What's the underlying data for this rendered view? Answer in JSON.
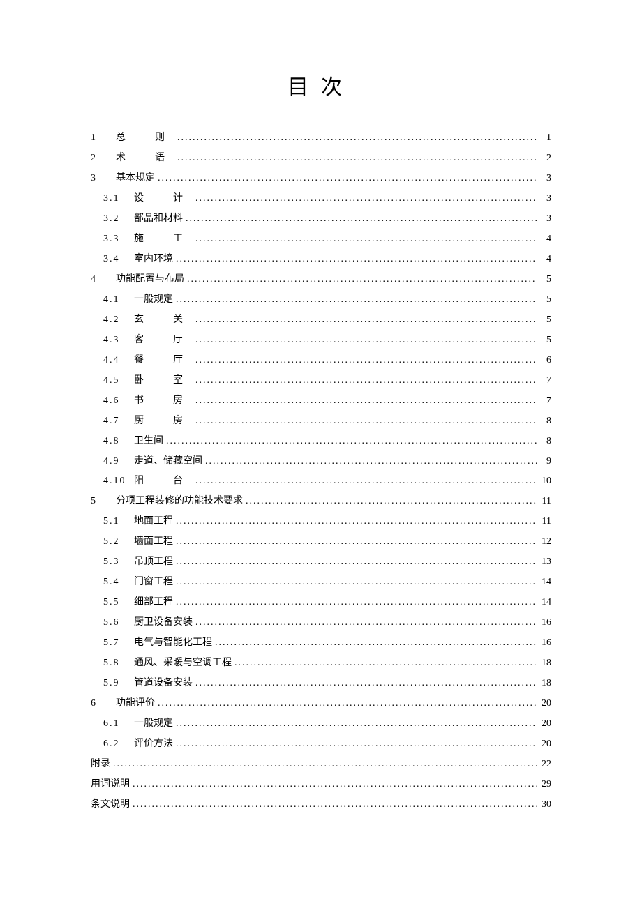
{
  "title": "目次",
  "entries": [
    {
      "level": 1,
      "num": "1",
      "label": "总　则",
      "spaced": 2,
      "page": "1"
    },
    {
      "level": 1,
      "num": "2",
      "label": "术　语",
      "spaced": 2,
      "page": "2"
    },
    {
      "level": 1,
      "num": "3",
      "label": "基本规定",
      "spaced": 0,
      "page": "3"
    },
    {
      "level": 2,
      "num": "3.1",
      "label": "设　计",
      "spaced": 2,
      "page": "3"
    },
    {
      "level": 2,
      "num": "3.2",
      "label": "部品和材料",
      "spaced": 0,
      "page": "3"
    },
    {
      "level": 2,
      "num": "3.3",
      "label": "施　工",
      "spaced": 2,
      "page": "4"
    },
    {
      "level": 2,
      "num": "3.4",
      "label": "室内环境",
      "spaced": 0,
      "page": "4"
    },
    {
      "level": 1,
      "num": "4",
      "label": "功能配置与布局",
      "spaced": 0,
      "page": "5"
    },
    {
      "level": 2,
      "num": "4.1",
      "label": "一般规定",
      "spaced": 0,
      "page": "5"
    },
    {
      "level": 2,
      "num": "4.2",
      "label": "玄　关",
      "spaced": 2,
      "page": "5"
    },
    {
      "level": 2,
      "num": "4.3",
      "label": "客　厅",
      "spaced": 2,
      "page": "5"
    },
    {
      "level": 2,
      "num": "4.4",
      "label": "餐　厅",
      "spaced": 2,
      "page": "6"
    },
    {
      "level": 2,
      "num": "4.5",
      "label": "卧　室",
      "spaced": 2,
      "page": "7"
    },
    {
      "level": 2,
      "num": "4.6",
      "label": "书　房",
      "spaced": 2,
      "page": "7"
    },
    {
      "level": 2,
      "num": "4.7",
      "label": "厨　房",
      "spaced": 2,
      "page": "8"
    },
    {
      "level": 2,
      "num": "4.8",
      "label": "卫生间",
      "spaced": 0,
      "page": "8"
    },
    {
      "level": 2,
      "num": "4.9",
      "label": "走道、储藏空间",
      "spaced": 0,
      "page": "9"
    },
    {
      "level": 2,
      "num": "4.10",
      "label": "阳　台",
      "spaced": 2,
      "page": "10"
    },
    {
      "level": 1,
      "num": "5",
      "label": "分项工程装修的功能技术要求",
      "spaced": 0,
      "page": "11"
    },
    {
      "level": 2,
      "num": "5.1",
      "label": "地面工程",
      "spaced": 0,
      "page": "11"
    },
    {
      "level": 2,
      "num": "5.2",
      "label": "墙面工程",
      "spaced": 0,
      "page": "12"
    },
    {
      "level": 2,
      "num": "5.3",
      "label": "吊顶工程",
      "spaced": 0,
      "page": "13"
    },
    {
      "level": 2,
      "num": "5.4",
      "label": "门窗工程",
      "spaced": 0,
      "page": "14"
    },
    {
      "level": 2,
      "num": "5.5",
      "label": "细部工程",
      "spaced": 0,
      "page": "14"
    },
    {
      "level": 2,
      "num": "5.6",
      "label": "厨卫设备安装",
      "spaced": 0,
      "page": "16"
    },
    {
      "level": 2,
      "num": "5.7",
      "label": "电气与智能化工程",
      "spaced": 0,
      "page": "16"
    },
    {
      "level": 2,
      "num": "5.8",
      "label": "通风、采暖与空调工程",
      "spaced": 0,
      "page": "18"
    },
    {
      "level": 2,
      "num": "5.9",
      "label": "管道设备安装",
      "spaced": 0,
      "page": "18"
    },
    {
      "level": 1,
      "num": "6",
      "label": "功能评价",
      "spaced": 0,
      "page": "20"
    },
    {
      "level": 2,
      "num": "6.1",
      "label": "一般规定",
      "spaced": 0,
      "page": "20"
    },
    {
      "level": 2,
      "num": "6.2",
      "label": "评价方法",
      "spaced": 0,
      "page": "20"
    },
    {
      "level": 0,
      "num": "",
      "label": "附录",
      "spaced": 0,
      "page": "22"
    },
    {
      "level": 0,
      "num": "",
      "label": "用词说明",
      "spaced": 0,
      "page": "29"
    },
    {
      "level": 0,
      "num": "",
      "label": "条文说明",
      "spaced": 0,
      "page": "30"
    }
  ]
}
